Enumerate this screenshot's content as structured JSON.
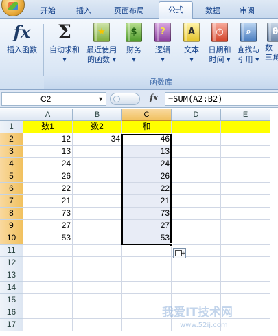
{
  "ribbon_tabs": [
    {
      "label": "开始",
      "active": false
    },
    {
      "label": "插入",
      "active": false
    },
    {
      "label": "页面布局",
      "active": false
    },
    {
      "label": "公式",
      "active": true
    },
    {
      "label": "数据",
      "active": false
    },
    {
      "label": "审阅",
      "active": false
    }
  ],
  "ribbon": {
    "insert_function": {
      "line1": "插入函数",
      "line2": ""
    },
    "autosum": {
      "line1": "自动求和",
      "line2": "▾"
    },
    "recent": {
      "line1": "最近使用",
      "line2": "的函数 ▾"
    },
    "financial": {
      "line1": "财务",
      "line2": "▾"
    },
    "logical": {
      "line1": "逻辑",
      "line2": "▾"
    },
    "text": {
      "line1": "文本",
      "line2": "▾"
    },
    "datetime": {
      "line1": "日期和",
      "line2": "时间 ▾"
    },
    "lookup": {
      "line1": "查找与",
      "line2": "引用 ▾"
    },
    "math": {
      "line1": "数",
      "line2": "三角"
    },
    "group_label": "函数库"
  },
  "formula_bar": {
    "name_box": "C2",
    "fx_label": "fx",
    "formula": "=SUM(A2:B2)"
  },
  "sheet": {
    "columns": [
      "A",
      "B",
      "C",
      "D",
      "E"
    ],
    "selected_column": "C",
    "rows": [
      "1",
      "2",
      "3",
      "4",
      "5",
      "6",
      "7",
      "8",
      "9",
      "10",
      "11",
      "12",
      "13",
      "14",
      "15",
      "16",
      "17"
    ],
    "selected_rows": [
      "2",
      "3",
      "4",
      "5",
      "6",
      "7",
      "8",
      "9",
      "10"
    ],
    "header_row": {
      "A": "数1",
      "B": "数2",
      "C": "和"
    },
    "data": [
      {
        "A": "12",
        "B": "34",
        "C": "46"
      },
      {
        "A": "13",
        "B": "",
        "C": "13"
      },
      {
        "A": "24",
        "B": "",
        "C": "24"
      },
      {
        "A": "26",
        "B": "",
        "C": "26"
      },
      {
        "A": "22",
        "B": "",
        "C": "22"
      },
      {
        "A": "21",
        "B": "",
        "C": "21"
      },
      {
        "A": "73",
        "B": "",
        "C": "73"
      },
      {
        "A": "27",
        "B": "",
        "C": "27"
      },
      {
        "A": "53",
        "B": "",
        "C": "53"
      }
    ]
  },
  "watermark": {
    "text": "我爱IT技术网",
    "url": "www.52ij.com"
  }
}
